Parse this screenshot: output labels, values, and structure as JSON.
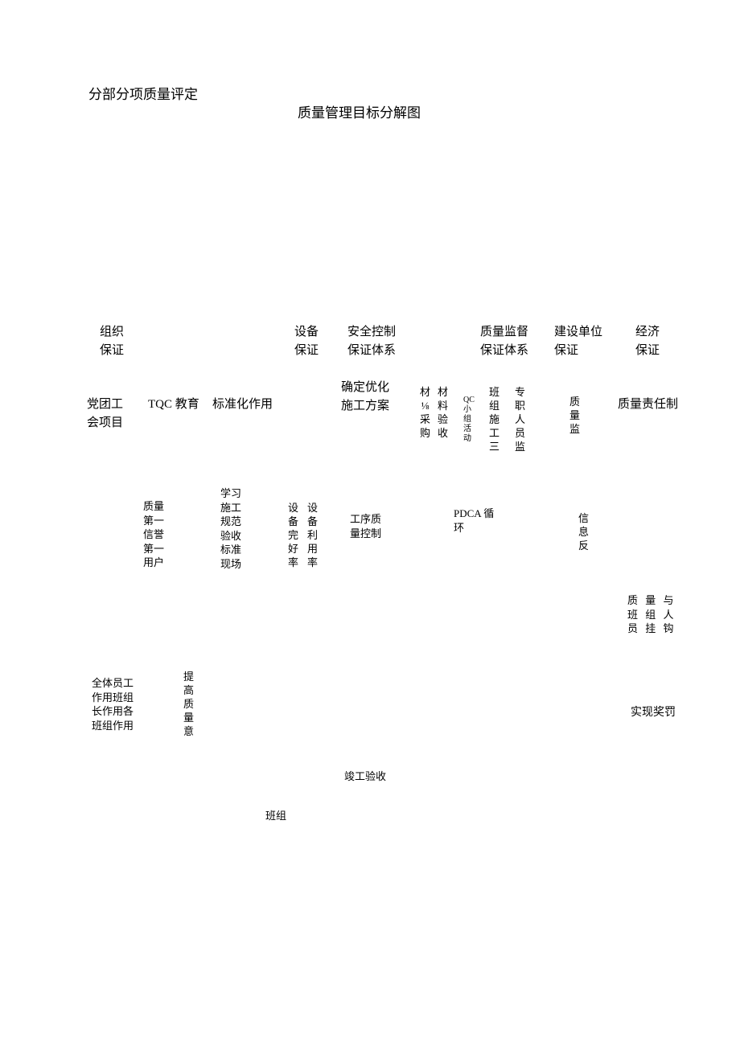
{
  "heading_left": "分部分项质量评定",
  "title": "质量管理目标分解图",
  "row1": {
    "c1": "组织\n保证",
    "c2": "设备\n保证",
    "c3": "安全控制\n保证体系",
    "c4": "质量监督\n保证体系",
    "c5": "建设单位\n保证",
    "c6": "经济\n保证"
  },
  "row2": {
    "c1": "党团工\n会项目",
    "c2": "TQC 教育",
    "c3": "标准化作用",
    "c4": "确定优化\n施工方案",
    "c5": "材⅛采购",
    "c6": "材料验收",
    "c7": "QC 小组活动",
    "c8": "班组施工三",
    "c9": "专职人员监",
    "c10": "质量监",
    "c11": "质量责任制"
  },
  "row3": {
    "c1": "质量\n第一\n信誉\n第一\n用户",
    "c2": "学习\n施工\n规范\n验收\n标准\n现场",
    "c3a": "设备完好率",
    "c3b": "设备利用率",
    "c4": "工序质\n量控制",
    "c5": "PDCA 循\n环",
    "c6": "信息反",
    "c7": "质 量 与\n班 组 人\n员 挂 钩"
  },
  "row4": {
    "c1": "全体员工\n作用班组\n长作用各\n班组作用",
    "c2": "提高质量意",
    "c3": "实现奖罚"
  },
  "bottom1": "竣工验收",
  "bottom2": "班组"
}
